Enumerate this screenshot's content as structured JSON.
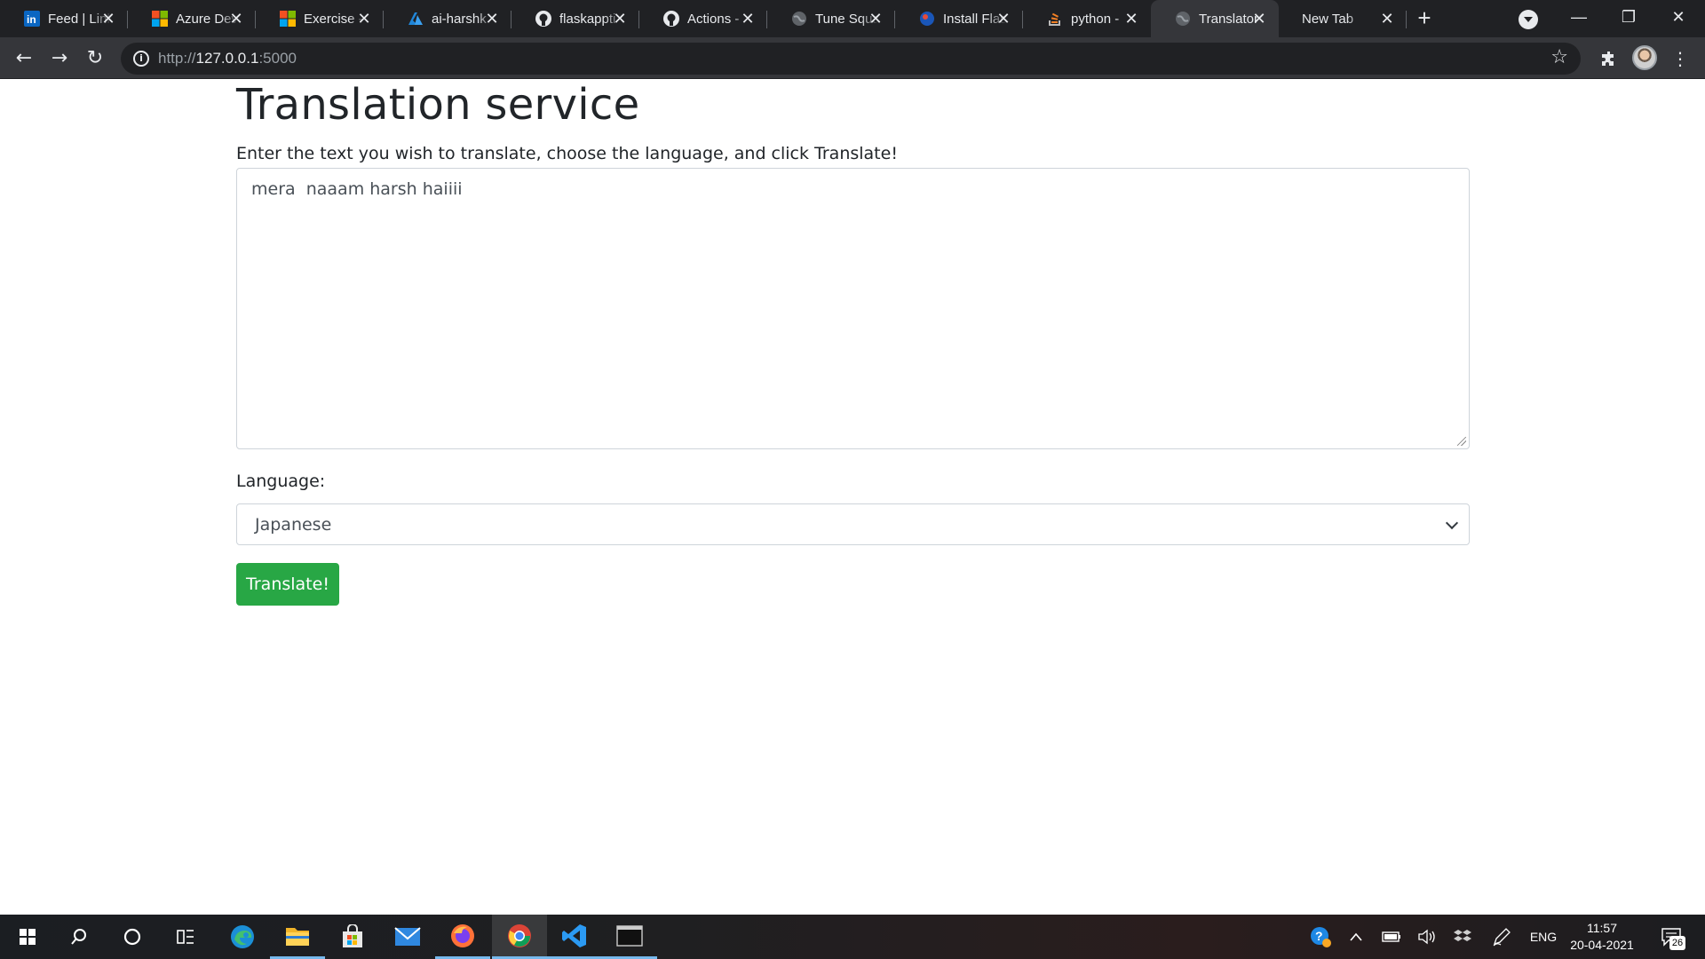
{
  "browser": {
    "tabs": [
      {
        "title": "Feed | LinkedIn",
        "icon": "linkedin-icon"
      },
      {
        "title": "Azure DevOps",
        "icon": "microsoft-icon"
      },
      {
        "title": "Exercise - ",
        "icon": "microsoft-icon"
      },
      {
        "title": "ai-harshk",
        "icon": "azure-icon"
      },
      {
        "title": "flaskappti",
        "icon": "github-icon"
      },
      {
        "title": "Actions - ",
        "icon": "github-icon"
      },
      {
        "title": "Tune Squad",
        "icon": "globe-icon"
      },
      {
        "title": "Install Flask",
        "icon": "globe-blue-icon"
      },
      {
        "title": "python - ",
        "icon": "stackoverflow-icon"
      },
      {
        "title": "Translator",
        "icon": "globe-icon",
        "active": true
      },
      {
        "title": "New Tab",
        "icon": ""
      }
    ],
    "new_tab_label": "+",
    "url_scheme": "http://",
    "url_host": "127.0.0.1",
    "url_port": ":5000"
  },
  "page": {
    "title": "Translation service",
    "instructions": "Enter the text you wish to translate, choose the language, and click Translate!",
    "text_input_value": "mera  naaam harsh haiiii",
    "language_label": "Language:",
    "language_selected": "Japanese",
    "translate_button": "Translate!"
  },
  "taskbar": {
    "input_lang": "ENG",
    "time": "11:57",
    "date": "20-04-2021",
    "notification_count": "26"
  },
  "colors": {
    "accent_green": "#28a745",
    "browser_dark": "#202124",
    "toolbar": "#35363a"
  }
}
